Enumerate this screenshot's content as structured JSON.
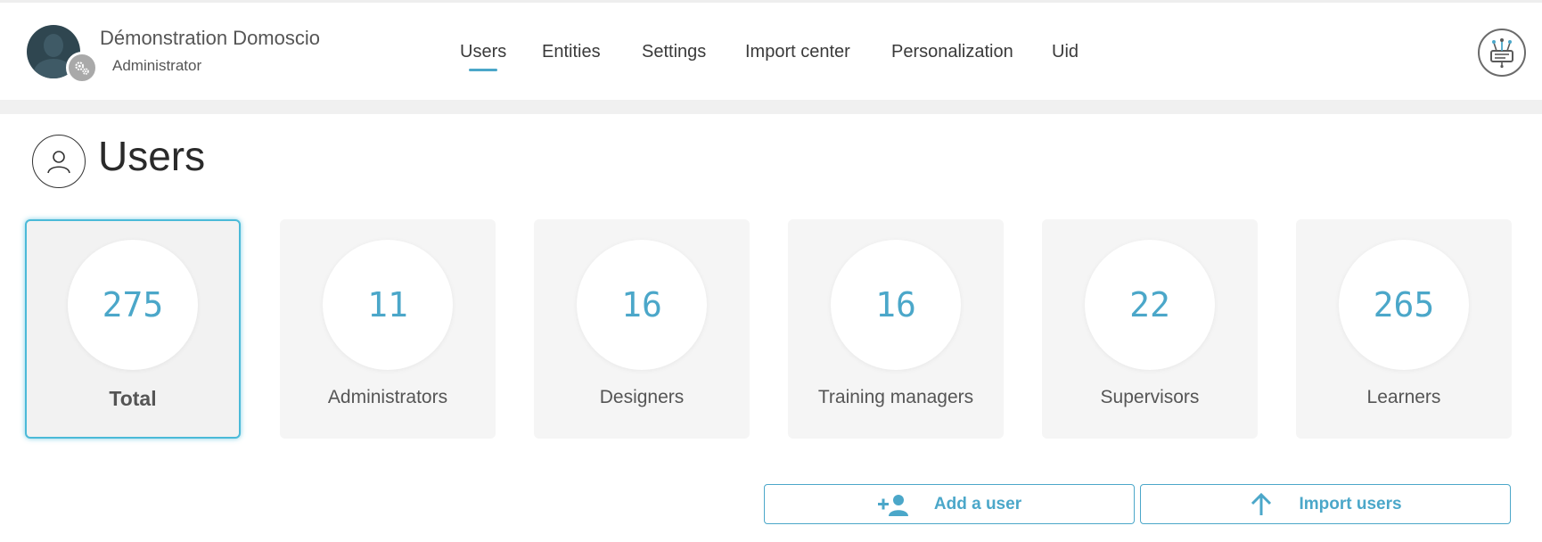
{
  "header": {
    "user_name": "Démonstration Domoscio",
    "user_role": "Administrator",
    "avatar_icon": "user-avatar",
    "role_icon": "gear-icon",
    "logo_icon": "brand-logo-icon",
    "nav": [
      {
        "label": "Users",
        "active": true
      },
      {
        "label": "Entities",
        "active": false
      },
      {
        "label": "Settings",
        "active": false
      },
      {
        "label": "Import center",
        "active": false
      },
      {
        "label": "Personalization",
        "active": false
      },
      {
        "label": "Uid",
        "active": false
      }
    ]
  },
  "page": {
    "title": "Users",
    "title_icon": "user-outline-icon"
  },
  "stats": [
    {
      "count": "275",
      "label": "Total",
      "selected": true
    },
    {
      "count": "11",
      "label": "Administrators",
      "selected": false
    },
    {
      "count": "16",
      "label": "Designers",
      "selected": false
    },
    {
      "count": "16",
      "label": "Training managers",
      "selected": false
    },
    {
      "count": "22",
      "label": "Supervisors",
      "selected": false
    },
    {
      "count": "265",
      "label": "Learners",
      "selected": false
    }
  ],
  "actions": {
    "add_user": {
      "label": "Add a user",
      "icon": "add-user-icon"
    },
    "import_users": {
      "label": "Import users",
      "icon": "arrow-up-icon"
    }
  },
  "colors": {
    "accent": "#4ba7c9",
    "card_bg": "#f5f5f5",
    "selected_border": "#4bbad8"
  }
}
